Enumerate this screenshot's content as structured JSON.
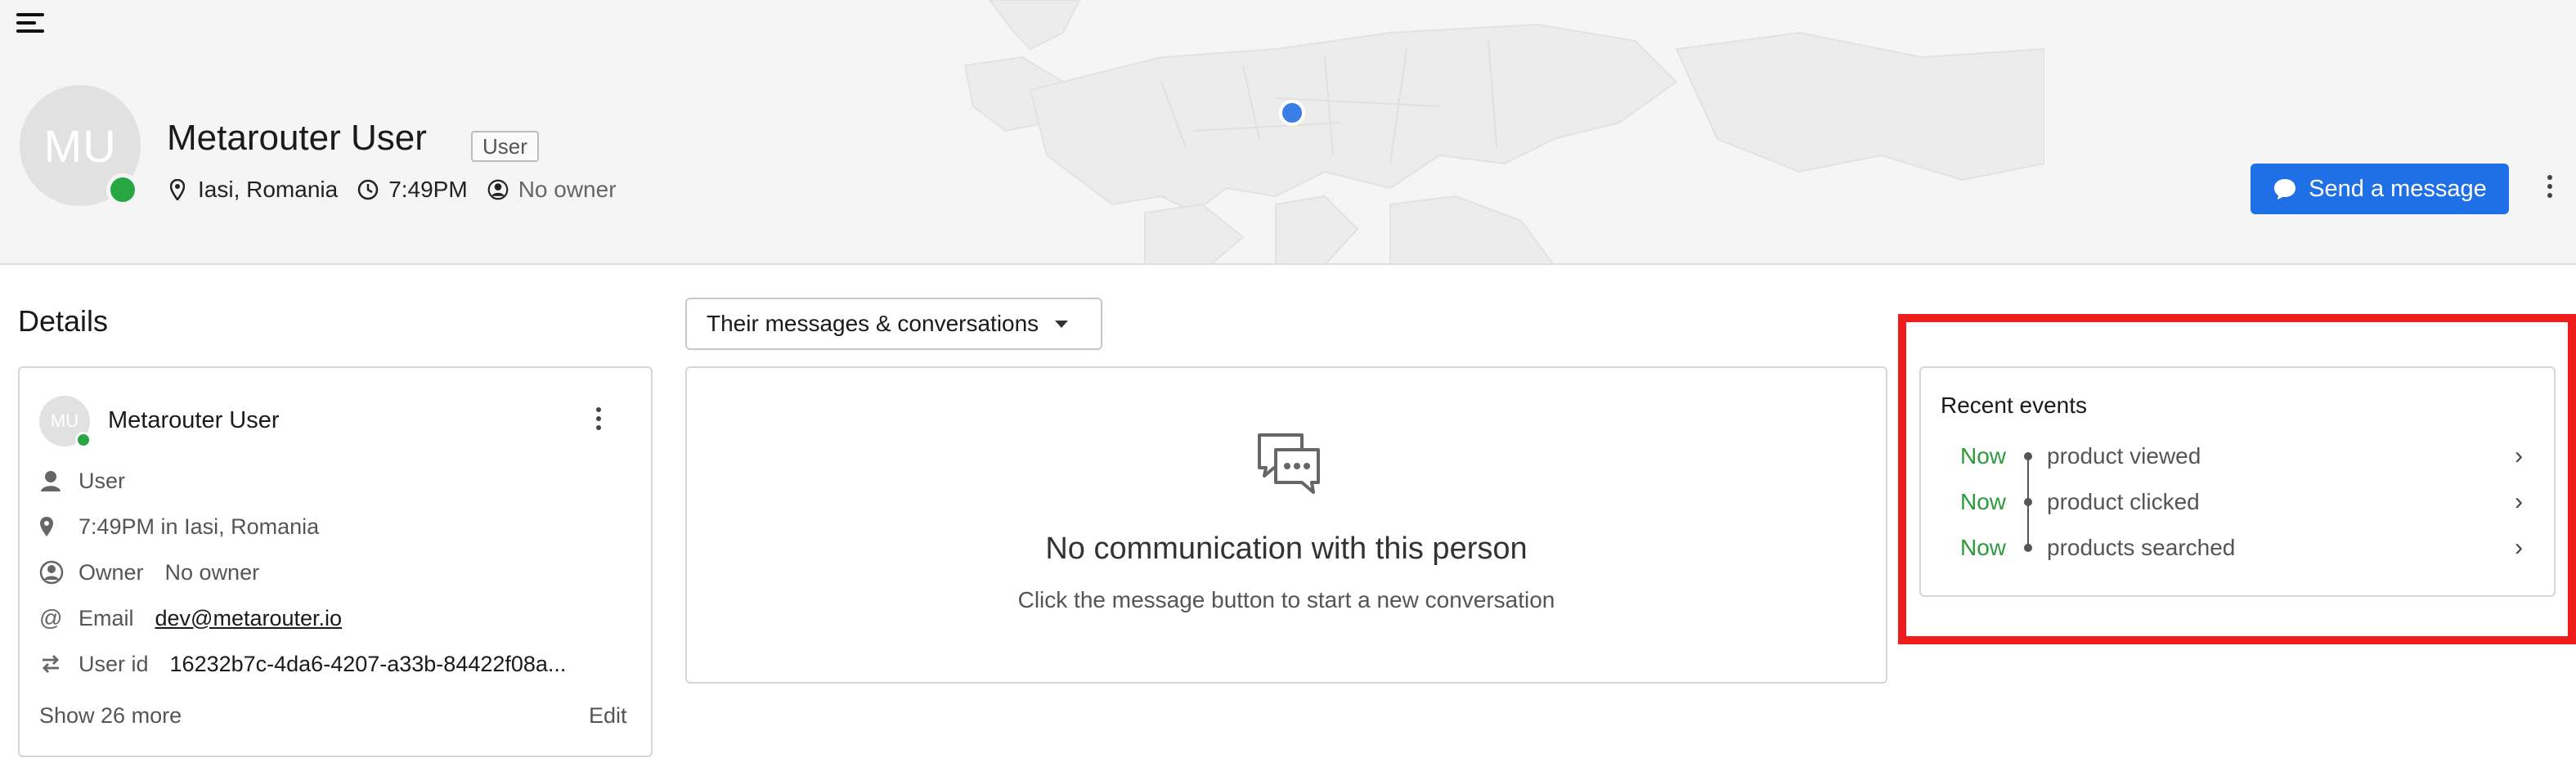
{
  "header": {
    "avatar_initials": "MU",
    "name": "Metarouter User",
    "role_chip": "User",
    "location": "Iasi, Romania",
    "local_time": "7:49PM",
    "owner": "No owner",
    "send_button": "Send a message",
    "presence_color": "#27a744"
  },
  "details": {
    "title": "Details",
    "avatar_initials": "MU",
    "name": "Metarouter User",
    "type_value": "User",
    "location_value": "7:49PM in Iasi, Romania",
    "owner_label": "Owner",
    "owner_value": "No owner",
    "email_label": "Email",
    "email_value": "dev@metarouter.io",
    "userid_label": "User id",
    "userid_value": "16232b7c-4da6-4207-a33b-84422f08a...",
    "show_more": "Show 26 more",
    "edit": "Edit"
  },
  "conversations": {
    "filter_label": "Their messages & conversations",
    "empty_title": "No communication with this person",
    "empty_subtitle": "Click the message button to start a new conversation"
  },
  "events": {
    "title": "Recent events",
    "items": [
      {
        "time": "Now",
        "name": "product viewed"
      },
      {
        "time": "Now",
        "name": "product clicked"
      },
      {
        "time": "Now",
        "name": "products searched"
      }
    ]
  },
  "colors": {
    "accent": "#1f6fe6",
    "highlight": "#ef1c1c",
    "event_time": "#2a9d3a"
  },
  "icons": [
    "menu-icon",
    "map-pin-icon",
    "clock-icon",
    "owner-globe-icon",
    "chat-bubble-icon",
    "kebab-menu-icon",
    "person-icon",
    "at-icon",
    "transfer-icon",
    "chevron-right-icon",
    "conversation-icon",
    "caret-down-icon"
  ]
}
